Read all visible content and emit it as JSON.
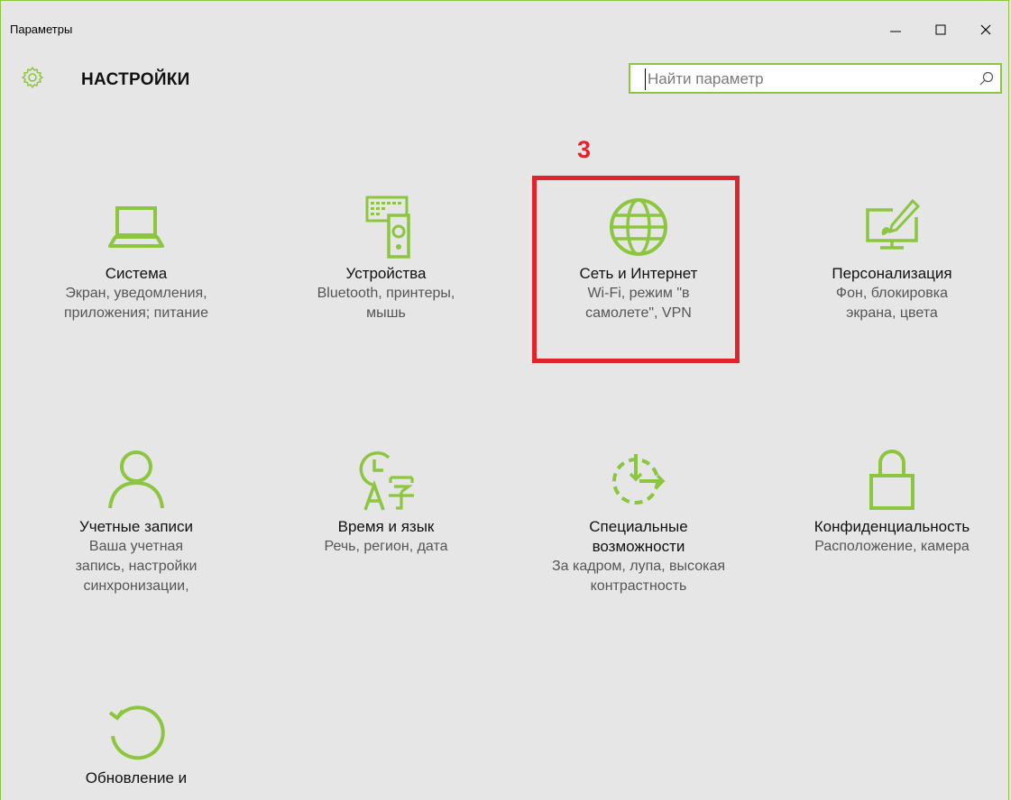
{
  "window": {
    "title": "Параметры",
    "minimize_icon": "minimize-icon",
    "maximize_icon": "maximize-icon",
    "close_icon": "close-icon"
  },
  "header": {
    "icon": "gear-icon",
    "title": "НАСТРОЙКИ"
  },
  "search": {
    "placeholder": "Найти параметр",
    "value": "",
    "icon": "search-icon"
  },
  "annotation": {
    "number": "3",
    "color": "#e0242b"
  },
  "accent_color": "#8cc63f",
  "tiles": [
    {
      "id": "system",
      "icon": "laptop-icon",
      "title": "Система",
      "desc": "Экран, уведомления, приложения; питание"
    },
    {
      "id": "devices",
      "icon": "devices-icon",
      "title": "Устройства",
      "desc": "Bluetooth, принтеры, мышь"
    },
    {
      "id": "network",
      "icon": "globe-icon",
      "title": "Сеть и Интернет",
      "desc": "Wi-Fi, режим \"в самолете\", VPN"
    },
    {
      "id": "personalization",
      "icon": "personalization-icon",
      "title": "Персонализация",
      "desc": "Фон, блокировка экрана, цвета"
    },
    {
      "id": "accounts",
      "icon": "person-icon",
      "title": "Учетные записи",
      "desc": "Ваша учетная запись, настройки синхронизации,"
    },
    {
      "id": "time-language",
      "icon": "time-language-icon",
      "title": "Время и язык",
      "desc": "Речь, регион, дата"
    },
    {
      "id": "accessibility",
      "icon": "accessibility-icon",
      "title": "Специальные возможности",
      "desc": "За кадром, лупа, высокая контрастность"
    },
    {
      "id": "privacy",
      "icon": "lock-icon",
      "title": "Конфиденциальность",
      "desc": "Расположение, камера"
    },
    {
      "id": "update",
      "icon": "update-icon",
      "title": "Обновление и",
      "desc": ""
    }
  ]
}
